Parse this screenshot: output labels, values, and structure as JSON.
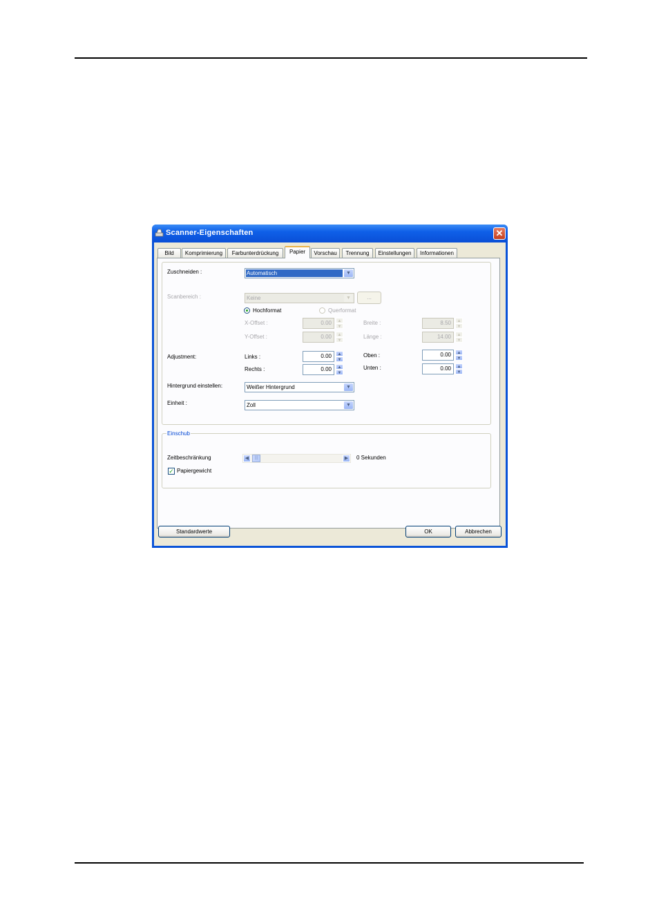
{
  "window": {
    "title": "Scanner-Eigenschaften",
    "close_glyph": "✕"
  },
  "tabs": [
    {
      "label": "Bild"
    },
    {
      "label": "Komprimierung"
    },
    {
      "label": "Farbunterdrückung"
    },
    {
      "label": "Papier"
    },
    {
      "label": "Vorschau"
    },
    {
      "label": "Trennung"
    },
    {
      "label": "Einstellungen"
    },
    {
      "label": "Informationen"
    }
  ],
  "paper": {
    "crop": {
      "label": "Zuschneiden :",
      "value": "Automatisch"
    },
    "scan_area": {
      "label": "Scanbereich :",
      "value": "Keine",
      "browse_label": "..."
    },
    "orientation": {
      "portrait": "Hochformat",
      "landscape": "Querformat"
    },
    "x_offset": {
      "label": "X-Offset :",
      "value": "0.00"
    },
    "y_offset": {
      "label": "Y-Offset :",
      "value": "0.00"
    },
    "width": {
      "label": "Breite :",
      "value": "8.50"
    },
    "length": {
      "label": "Länge :",
      "value": "14.00"
    },
    "adjustment": {
      "label": "Adjustment:"
    },
    "left": {
      "label": "Links :",
      "value": "0.00"
    },
    "right": {
      "label": "Rechts :",
      "value": "0.00"
    },
    "top": {
      "label": "Oben :",
      "value": "0.00"
    },
    "bottom": {
      "label": "Unten :",
      "value": "0.00"
    },
    "background": {
      "label": "Hintergrund einstellen:",
      "value": "Weißer Hintergrund"
    },
    "unit": {
      "label": "Einheit :",
      "value": "Zoll"
    }
  },
  "feed": {
    "group_label": "Einschub",
    "timeout": {
      "label": "Zeitbeschränkung",
      "value_text": "0 Sekunden"
    },
    "paper_weight": {
      "label": "Papiergewicht",
      "checked": true
    }
  },
  "footer": {
    "defaults_label": "Standardwerte",
    "ok_label": "OK",
    "cancel_label": "Abbrechen"
  },
  "glyphs": {
    "dropdown": "▼",
    "up": "▲",
    "down": "▼",
    "left": "◀",
    "right": "▶",
    "check": "✓",
    "thumb": "|||"
  }
}
